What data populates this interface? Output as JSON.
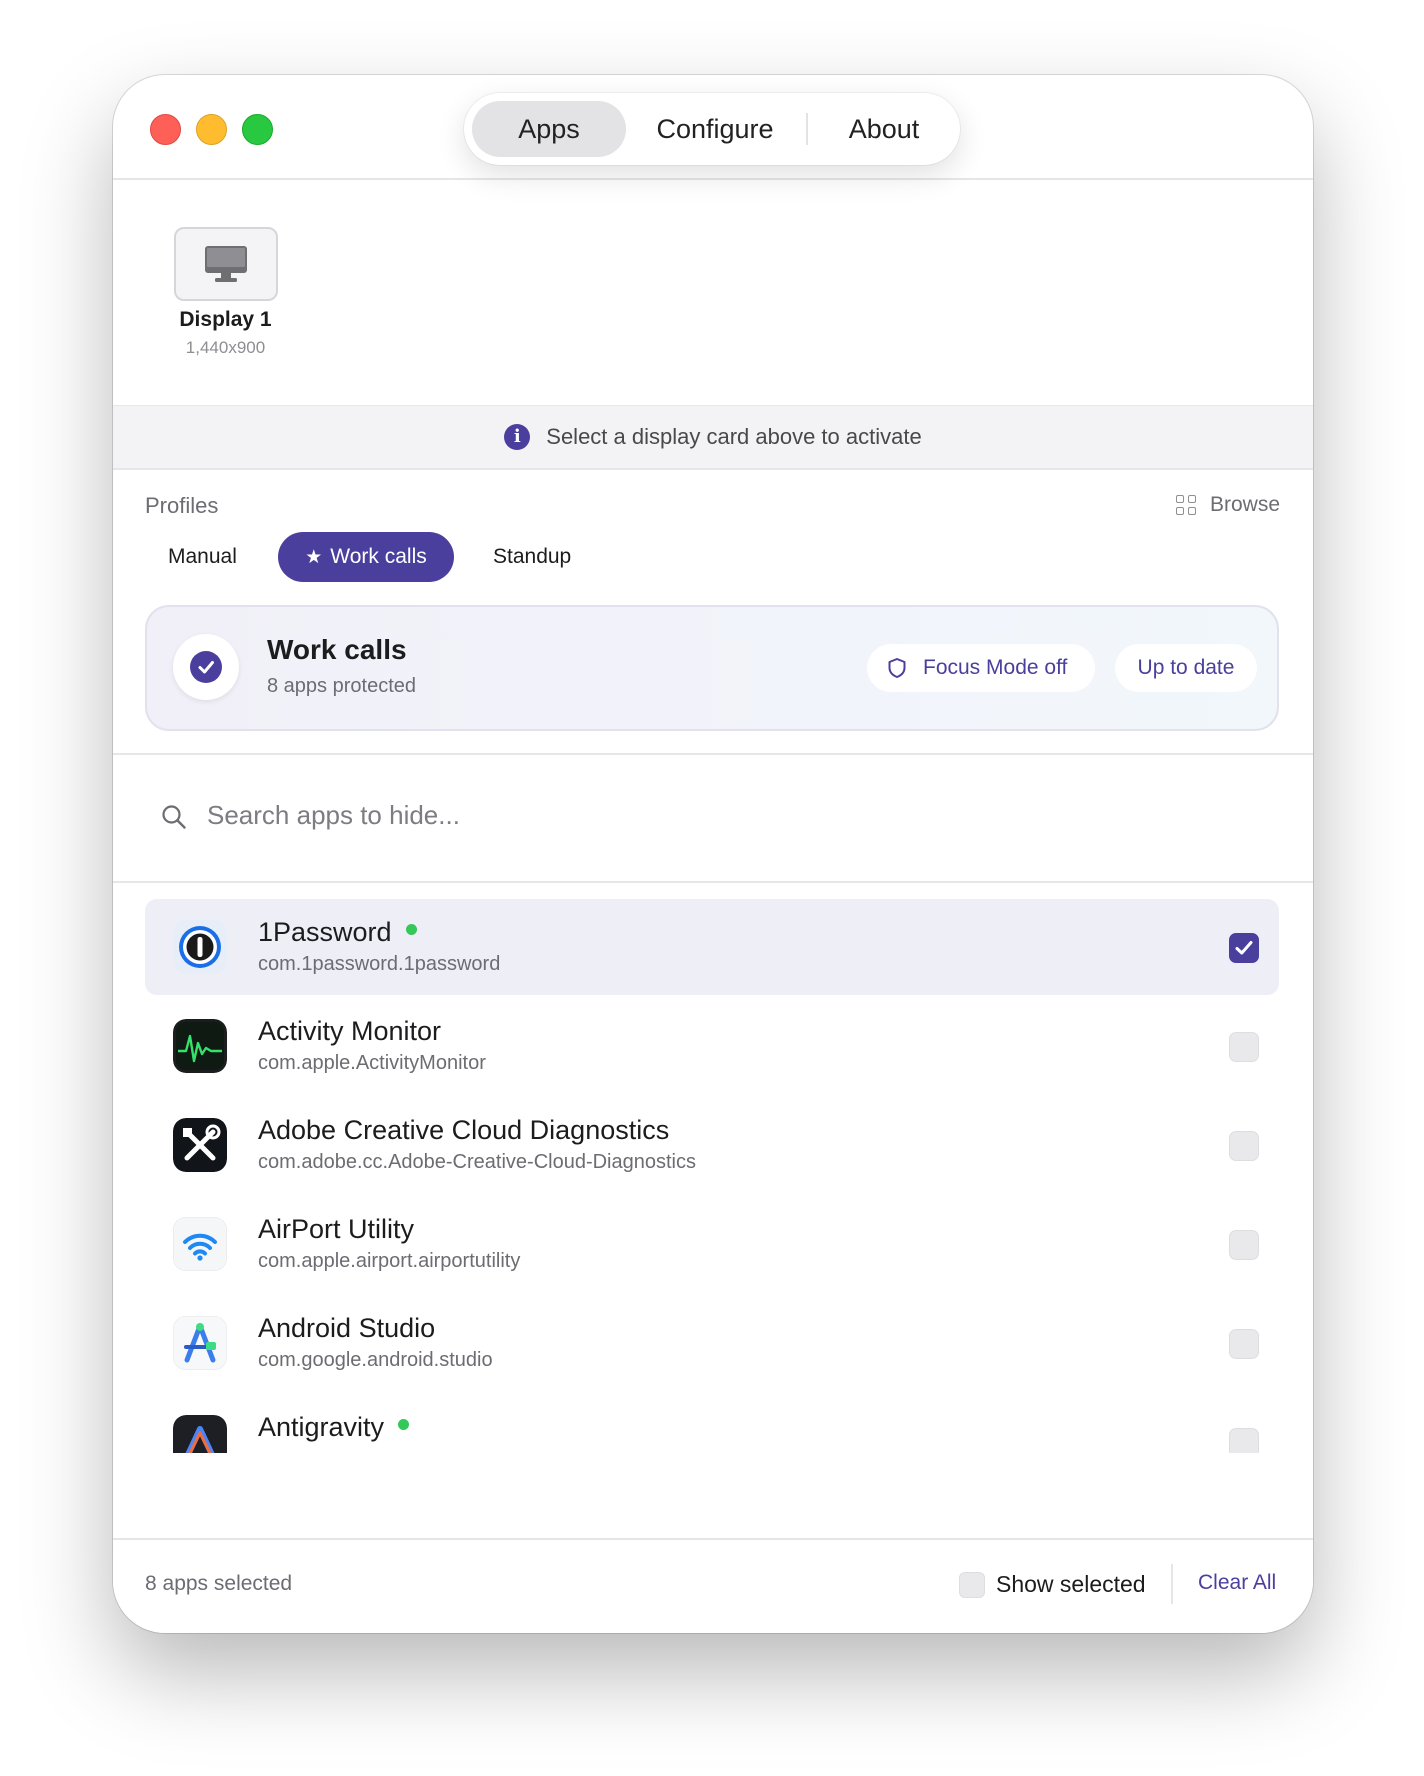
{
  "window": {
    "tabs": [
      {
        "label": "Apps",
        "selected": true
      },
      {
        "label": "Configure",
        "selected": false
      },
      {
        "label": "About",
        "selected": false
      }
    ]
  },
  "display": {
    "name": "Display 1",
    "resolution": "1,440x900",
    "icon": "monitor-icon"
  },
  "info_banner": {
    "text": "Select a display card above to activate",
    "icon": "info-icon"
  },
  "profiles": {
    "label": "Profiles",
    "browse_label": "Browse",
    "chips": [
      "Manual",
      "Work calls",
      "Standup"
    ],
    "active_index": 1
  },
  "active_profile": {
    "title": "Work calls",
    "subtitle": "8 apps protected",
    "focus_label": "Focus Mode off",
    "status_label": "Up to date"
  },
  "search": {
    "placeholder": "Search apps to hide...",
    "value": ""
  },
  "apps": [
    {
      "name": "1Password",
      "bundle": "com.1password.1password",
      "running": true,
      "selected": true,
      "icon": "1password-icon"
    },
    {
      "name": "Activity Monitor",
      "bundle": "com.apple.ActivityMonitor",
      "running": false,
      "selected": false,
      "icon": "activity-monitor-icon"
    },
    {
      "name": "Adobe Creative Cloud Diagnostics",
      "bundle": "com.adobe.cc.Adobe-Creative-Cloud-Diagnostics",
      "running": false,
      "selected": false,
      "icon": "adobe-diagnostics-icon"
    },
    {
      "name": "AirPort Utility",
      "bundle": "com.apple.airport.airportutility",
      "running": false,
      "selected": false,
      "icon": "airport-utility-icon"
    },
    {
      "name": "Android Studio",
      "bundle": "com.google.android.studio",
      "running": false,
      "selected": false,
      "icon": "android-studio-icon"
    },
    {
      "name": "Antigravity",
      "bundle": "",
      "running": true,
      "selected": false,
      "icon": "antigravity-icon"
    }
  ],
  "footer": {
    "count_label": "8 apps selected",
    "show_selected_label": "Show selected",
    "clear_label": "Clear All"
  },
  "colors": {
    "accent": "#4b3f9e",
    "running_dot": "#34c759",
    "selected_row": "#eeeef7"
  }
}
